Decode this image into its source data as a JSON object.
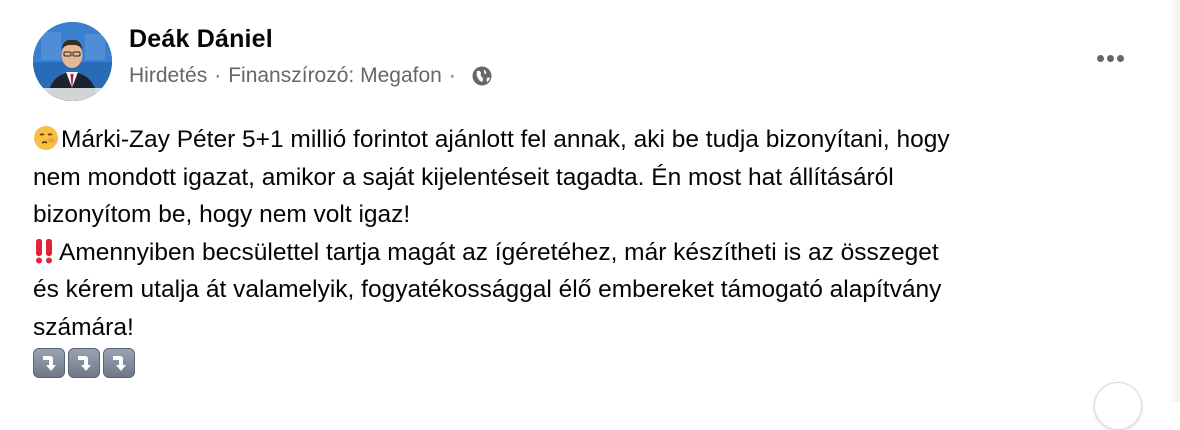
{
  "post": {
    "author": "Deák Dániel",
    "meta": {
      "sponsored": "Hirdetés",
      "separator": "·",
      "funder": "Finanszírozó: Megafon",
      "privacy_icon": "globe-icon"
    },
    "text_lines": [
      "Márki-Zay Péter 5+1 millió forintot ajánlott fel annak, aki be tudja bizonyítani, hogy",
      "nem mondott igazat, amikor a saját kijelentéseit tagadta. Én most hat állításáról",
      "bizonyítom be, hogy nem volt igaz!",
      "Amennyiben becsülettel tartja magát az ígéretéhez, már készítheti is az összeget",
      "és kérem utalja át valamelyik, fogyatékossággal élő embereket támogató alapítvány",
      "számára!"
    ],
    "emojis": {
      "line1": "lying-face-emoji",
      "line4": "double-exclamation-emoji",
      "arrows": [
        "down-arrow-emoji",
        "down-arrow-emoji",
        "down-arrow-emoji"
      ]
    }
  },
  "colors": {
    "meta_gray": "#65676b",
    "text": "#050505",
    "exclamation_red": "#e0243a"
  }
}
